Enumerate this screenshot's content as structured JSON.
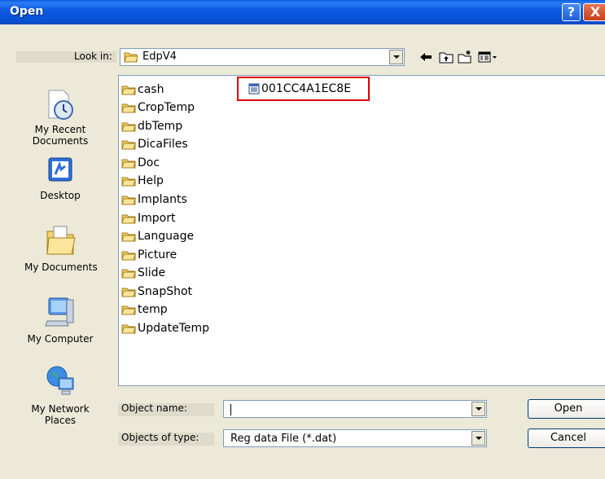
{
  "window": {
    "title": "Open"
  },
  "title_buttons": {
    "help": "?",
    "close": "X"
  },
  "lookin": {
    "label": "Look in:",
    "value": "EdpV4"
  },
  "toolbar": {
    "icons": [
      "back-arrow-icon",
      "up-folder-icon",
      "new-folder-icon",
      "views-menu-icon"
    ]
  },
  "places": [
    {
      "label": "My Recent\nDocuments",
      "icon": "recent-documents-icon"
    },
    {
      "label": "Desktop",
      "icon": "desktop-icon"
    },
    {
      "label": "My Documents",
      "icon": "my-documents-icon"
    },
    {
      "label": "My Computer",
      "icon": "my-computer-icon"
    },
    {
      "label": "My Network\nPlaces",
      "icon": "network-places-icon"
    }
  ],
  "folders": [
    "cash",
    "CropTemp",
    "dbTemp",
    "DicaFiles",
    "Doc",
    "Help",
    "Implants",
    "Import",
    "Language",
    "Picture",
    "Slide",
    "SnapShot",
    "temp",
    "UpdateTemp"
  ],
  "files": [
    "001CC4A1EC8E"
  ],
  "object_name": {
    "label": "Object name:",
    "value": ""
  },
  "object_type": {
    "label": "Objects of type:",
    "value": "Reg data File (*.dat)"
  },
  "buttons": {
    "open": "Open",
    "cancel": "Cancel"
  },
  "colors": {
    "title_bar": "#0A5FDF",
    "highlight_box": "#E00000",
    "dialog_bg": "#ECE9D8"
  }
}
